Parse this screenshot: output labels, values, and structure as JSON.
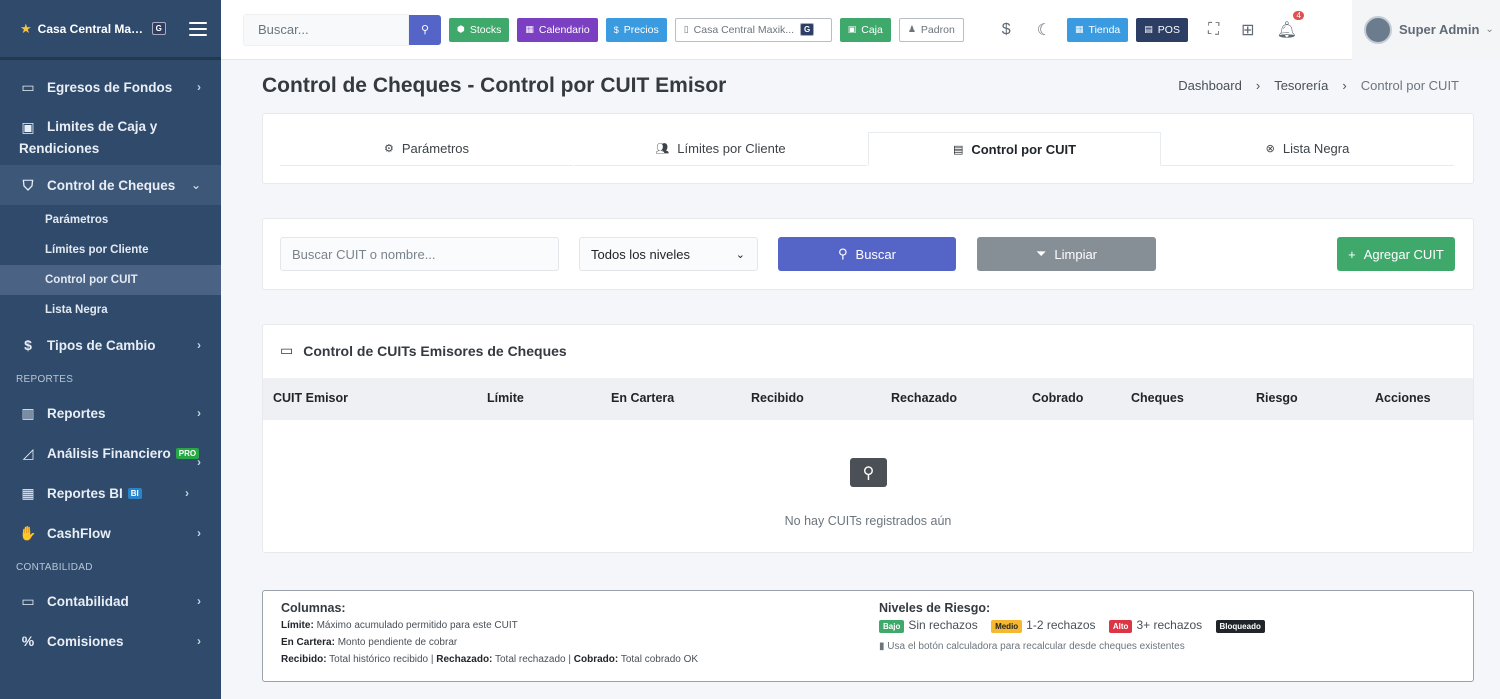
{
  "brand": {
    "name": "Casa Central Max...",
    "badge": "G"
  },
  "sidebar": {
    "items": [
      {
        "label": "Egresos de Fondos"
      },
      {
        "label": "Limites de Caja y",
        "label2": "Rendiciones"
      },
      {
        "label": "Control de Cheques"
      },
      {
        "label": "Tipos de Cambio"
      },
      {
        "label": "Reportes"
      },
      {
        "label": "Análisis Financiero",
        "badge": "PRO"
      },
      {
        "label": "Reportes BI",
        "badge": "BI"
      },
      {
        "label": "CashFlow"
      },
      {
        "label": "Contabilidad"
      },
      {
        "label": "Comisiones"
      }
    ],
    "subitems": [
      "Parámetros",
      "Límites por Cliente",
      "Control por CUIT",
      "Lista Negra"
    ],
    "sections": [
      "REPORTES",
      "CONTABILIDAD"
    ]
  },
  "topbar": {
    "search_placeholder": "Buscar...",
    "buttons": [
      {
        "label": "Stocks",
        "color": "#3fa96b"
      },
      {
        "label": "Calendario",
        "color": "#7b3fc2"
      },
      {
        "label": "Precios",
        "color": "#3b9be0"
      },
      {
        "label": "Casa Central Maxik...",
        "badge": "G"
      },
      {
        "label": "Caja",
        "color": "#3fa96b"
      },
      {
        "label": "Padron"
      },
      {
        "label": "Tienda",
        "color": "#3b9be0"
      },
      {
        "label": "POS",
        "color": "#2c3e63"
      }
    ],
    "notif_count": "4",
    "user": "Super Admin"
  },
  "page": {
    "title": "Control de Cheques - Control por CUIT Emisor",
    "breadcrumb": [
      "Dashboard",
      "Tesorería",
      "Control por CUIT"
    ]
  },
  "tabs": [
    "Parámetros",
    "Límites por Cliente",
    "Control por CUIT",
    "Lista Negra"
  ],
  "filters": {
    "search_placeholder": "Buscar CUIT o nombre...",
    "level_select": "Todos los niveles",
    "search_btn": "Buscar",
    "clear_btn": "Limpiar",
    "add_btn": "Agregar CUIT"
  },
  "table": {
    "title": "Control de CUITs Emisores de Cheques",
    "columns": [
      "CUIT Emisor",
      "Límite",
      "En Cartera",
      "Recibido",
      "Rechazado",
      "Cobrado",
      "Cheques",
      "Riesgo",
      "Acciones"
    ],
    "empty": "No hay CUITs registrados aún"
  },
  "legend": {
    "columns_title": "Columnas:",
    "limit_label": "Límite:",
    "limit_text": "Máximo acumulado permitido para este CUIT",
    "cartera_label": "En Cartera:",
    "cartera_text": "Monto pendiente de cobrar",
    "recibido_label": "Recibido:",
    "recibido_text": "Total histórico recibido |",
    "rechazado_label": "Rechazado:",
    "rechazado_text": "Total rechazado |",
    "cobrado_label": "Cobrado:",
    "cobrado_text": "Total cobrado OK",
    "risk_title": "Niveles de Riesgo:",
    "levels": [
      {
        "badge": "Bajo",
        "text": "Sin rechazos",
        "color": "#3fa96b"
      },
      {
        "badge": "Medio",
        "text": "1-2 rechazos",
        "color": "#f5b82e"
      },
      {
        "badge": "Alto",
        "text": "3+ rechazos",
        "color": "#dc3545"
      },
      {
        "badge": "Bloqueado",
        "text": "",
        "color": "#212529"
      }
    ],
    "note": "Usa el botón calculadora para recalcular desde cheques existentes"
  }
}
